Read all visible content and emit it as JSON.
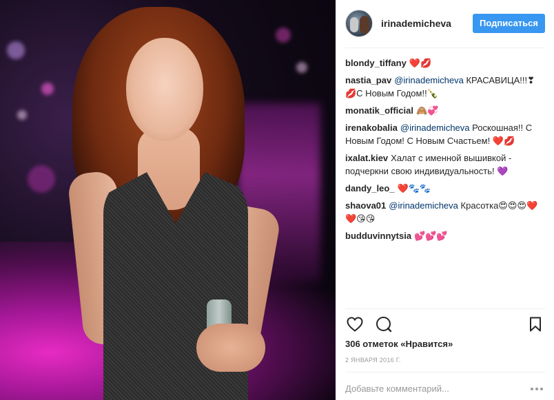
{
  "post": {
    "username": "irinademicheva",
    "follow_label": "Подписаться",
    "likes_text": "306 отметок «Нравится»",
    "date": "2 ЯНВАРЯ 2016 Г.",
    "comment_placeholder": "Добавьте комментарий..."
  },
  "comments": [
    {
      "author": "blondy_tiffany",
      "mention": "",
      "text": "❤️💋"
    },
    {
      "author": "nastia_pav",
      "mention": "@irinademicheva",
      "text": "КРАСАВИЦА!!!❣💋С Новым Годом!!🍾"
    },
    {
      "author": "monatik_official",
      "mention": "",
      "text": "🙈💞"
    },
    {
      "author": "irenakobalia",
      "mention": "@irinademicheva",
      "text": "Роскошная!! С Новым Годом! С Новым Счастьем! ❤️💋"
    },
    {
      "author": "ixalat.kiev",
      "mention": "",
      "text": "Халат с именной вышивкой - подчеркни свою индивидуальность! 💜"
    },
    {
      "author": "dandy_leo_",
      "mention": "",
      "text": "❤️🐾🐾"
    },
    {
      "author": "shaova01",
      "mention": "@irinademicheva",
      "text": "Красотка😍😍😍❤️❤️😘😘"
    },
    {
      "author": "budduvinnytsia",
      "mention": "",
      "text": "💕💕💕"
    }
  ],
  "icons": {
    "like": "heart-icon",
    "comment": "comment-bubble-icon",
    "save": "bookmark-icon",
    "more": "more-options-icon"
  },
  "colors": {
    "follow_button": "#3897f0",
    "mention": "#003569",
    "muted": "#999999"
  }
}
